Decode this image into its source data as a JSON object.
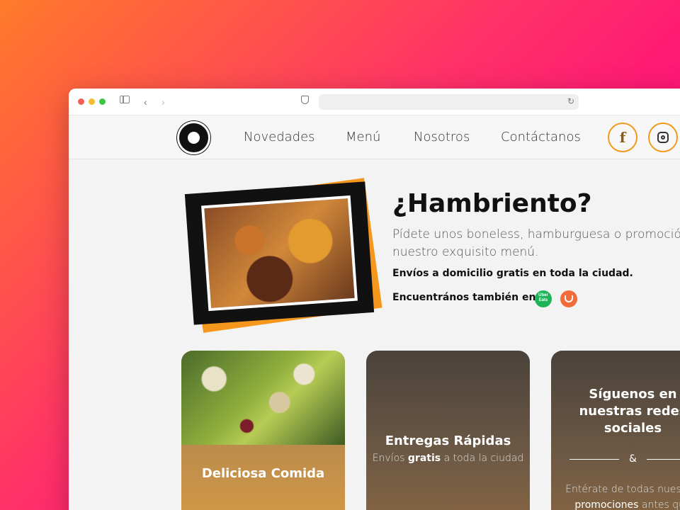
{
  "nav": {
    "links": [
      "Novedades",
      "Menú",
      "Nosotros",
      "Contáctanos"
    ],
    "social": {
      "facebook": "f",
      "instagram_icon": "instagram-icon"
    }
  },
  "hero": {
    "title": "¿Hambriento?",
    "text": "Pídete unos boneless, hamburguesa o promoción nuestro exquisito menú.",
    "free_delivery": "Envíos a domicilio gratis en toda la ciudad.",
    "find_us": "Encuentrános también en:",
    "platforms": [
      "Uber Eats",
      "DiDi Food"
    ]
  },
  "cards": {
    "food": {
      "title": "Deliciosa Comida"
    },
    "delivery": {
      "title": "Entregas Rápidas",
      "prefix": "Envíos",
      "highlight": "gratis",
      "suffix": "a toda la ciudad"
    },
    "social": {
      "title": "Síguenos en nuestras redes sociales",
      "ampersand": "&",
      "text_start": "Entérate de todas nuestras",
      "highlight": "promociones",
      "text_end": "antes que"
    }
  },
  "colors": {
    "accent": "#f29a1f",
    "gradient_start": "#ff7a2a",
    "gradient_end": "#d41ca6",
    "card_brown": "#6f5a45"
  }
}
